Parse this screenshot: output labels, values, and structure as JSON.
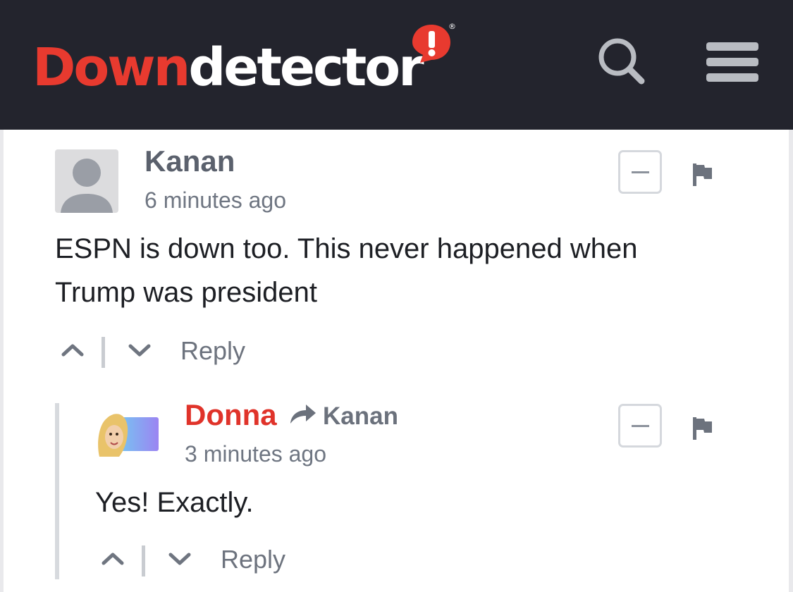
{
  "header": {
    "logo": {
      "part_red": "Down",
      "part_white": "detector",
      "badge_glyph": "!",
      "registered": "®"
    },
    "search_icon": "search-icon",
    "menu_icon": "hamburger-menu-icon",
    "colors": {
      "background": "#23242d",
      "brand_red": "#e83a2f"
    }
  },
  "comments": [
    {
      "author": "Kanan",
      "time": "6 minutes ago",
      "text_line1": "ESPN is down too. This never happened when",
      "text_line2": "Trump was president",
      "reply_label": "Reply",
      "avatar": "default-user-avatar"
    }
  ],
  "replies": [
    {
      "author": "Donna",
      "reply_to": "Kanan",
      "time": "3 minutes ago",
      "text": "Yes! Exactly.",
      "reply_label": "Reply",
      "avatar": "profile-photo-avatar"
    }
  ]
}
